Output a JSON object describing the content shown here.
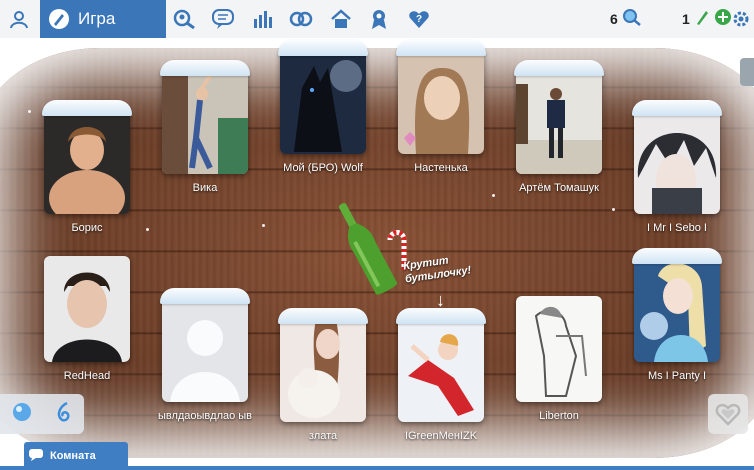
{
  "header": {
    "tab_game": "Игра",
    "counter_left": "6",
    "counter_right": "1"
  },
  "colors": {
    "accent": "#3a76b8",
    "icon_blue": "#3a76b8",
    "green": "#3aa64a"
  },
  "players": [
    {
      "name": "Борис",
      "photo": "boy-shirtless"
    },
    {
      "name": "Вика",
      "photo": "girl-stretch"
    },
    {
      "name": "Мой (БРО) Wolf",
      "photo": "black-wolf"
    },
    {
      "name": "Настенька",
      "photo": "girl-selfie"
    },
    {
      "name": "Артём Томашук",
      "photo": "boy-standing"
    },
    {
      "name": "I Mr I Sebo I",
      "photo": "anime-boy"
    },
    {
      "name": "RedHead",
      "photo": "boy-portrait"
    },
    {
      "name": "ывлдаоывдлао ыв",
      "photo": "default-avatar"
    },
    {
      "name": "злата",
      "photo": "girl-cat"
    },
    {
      "name": "IGreenMeнIZK",
      "photo": "anime-skater"
    },
    {
      "name": "Liberton",
      "photo": "anime-sketch"
    },
    {
      "name": "Ms I Panty I",
      "photo": "anime-elsa"
    }
  ],
  "spin_text_1": "Крутит",
  "spin_text_2": "бутылочку!",
  "footer": {
    "room_label": "Комната"
  }
}
